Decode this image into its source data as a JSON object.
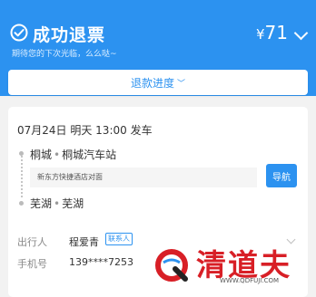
{
  "colors": {
    "primary": "#2c92f0",
    "brand_red": "#d81f26"
  },
  "header": {
    "status_icon": "check-circle-icon",
    "title": "成功退票",
    "subtitle": "期待您的下次光临，么么哒~",
    "amount_currency": "¥",
    "amount_value": "71",
    "amount_icon": "chevron-down-icon"
  },
  "progress": {
    "label": "退款进度",
    "icon": "chevron-down-icon"
  },
  "trip": {
    "departure": "07月24日 明天 13:00 发车",
    "from_city": "桐城",
    "from_station": "桐城汽车站",
    "separator": "•",
    "pickup_point": "新东方快捷酒店对面",
    "nav_button": "导航",
    "to_city": "芜湖",
    "to_station": "芜湖"
  },
  "passenger": {
    "label": "出行人",
    "name": "程爱青",
    "badge": "联系人",
    "phone_label": "手机号",
    "phone": "139****7253"
  },
  "watermark": {
    "text": "清道夫",
    "url": "WWW.QDFUJI.COM"
  }
}
